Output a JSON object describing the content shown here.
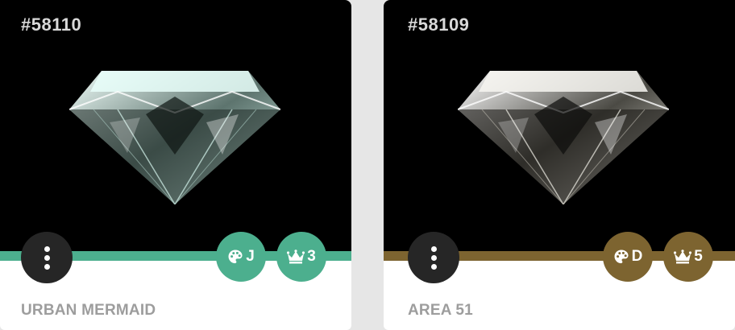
{
  "cards": [
    {
      "id_label": "#58110",
      "name": "URBAN MERMAID",
      "color_grade": "J",
      "rank": "3",
      "accent": "#4caf8e",
      "gem_tint": "#cfeee6",
      "icons": {
        "menu": "vertical-dots-icon",
        "color": "palette-icon",
        "rank": "crown-icon"
      }
    },
    {
      "id_label": "#58109",
      "name": "AREA 51",
      "color_grade": "D",
      "rank": "5",
      "accent": "#7d6430",
      "gem_tint": "#e8e6de",
      "icons": {
        "menu": "vertical-dots-icon",
        "color": "palette-icon",
        "rank": "crown-icon"
      }
    }
  ]
}
